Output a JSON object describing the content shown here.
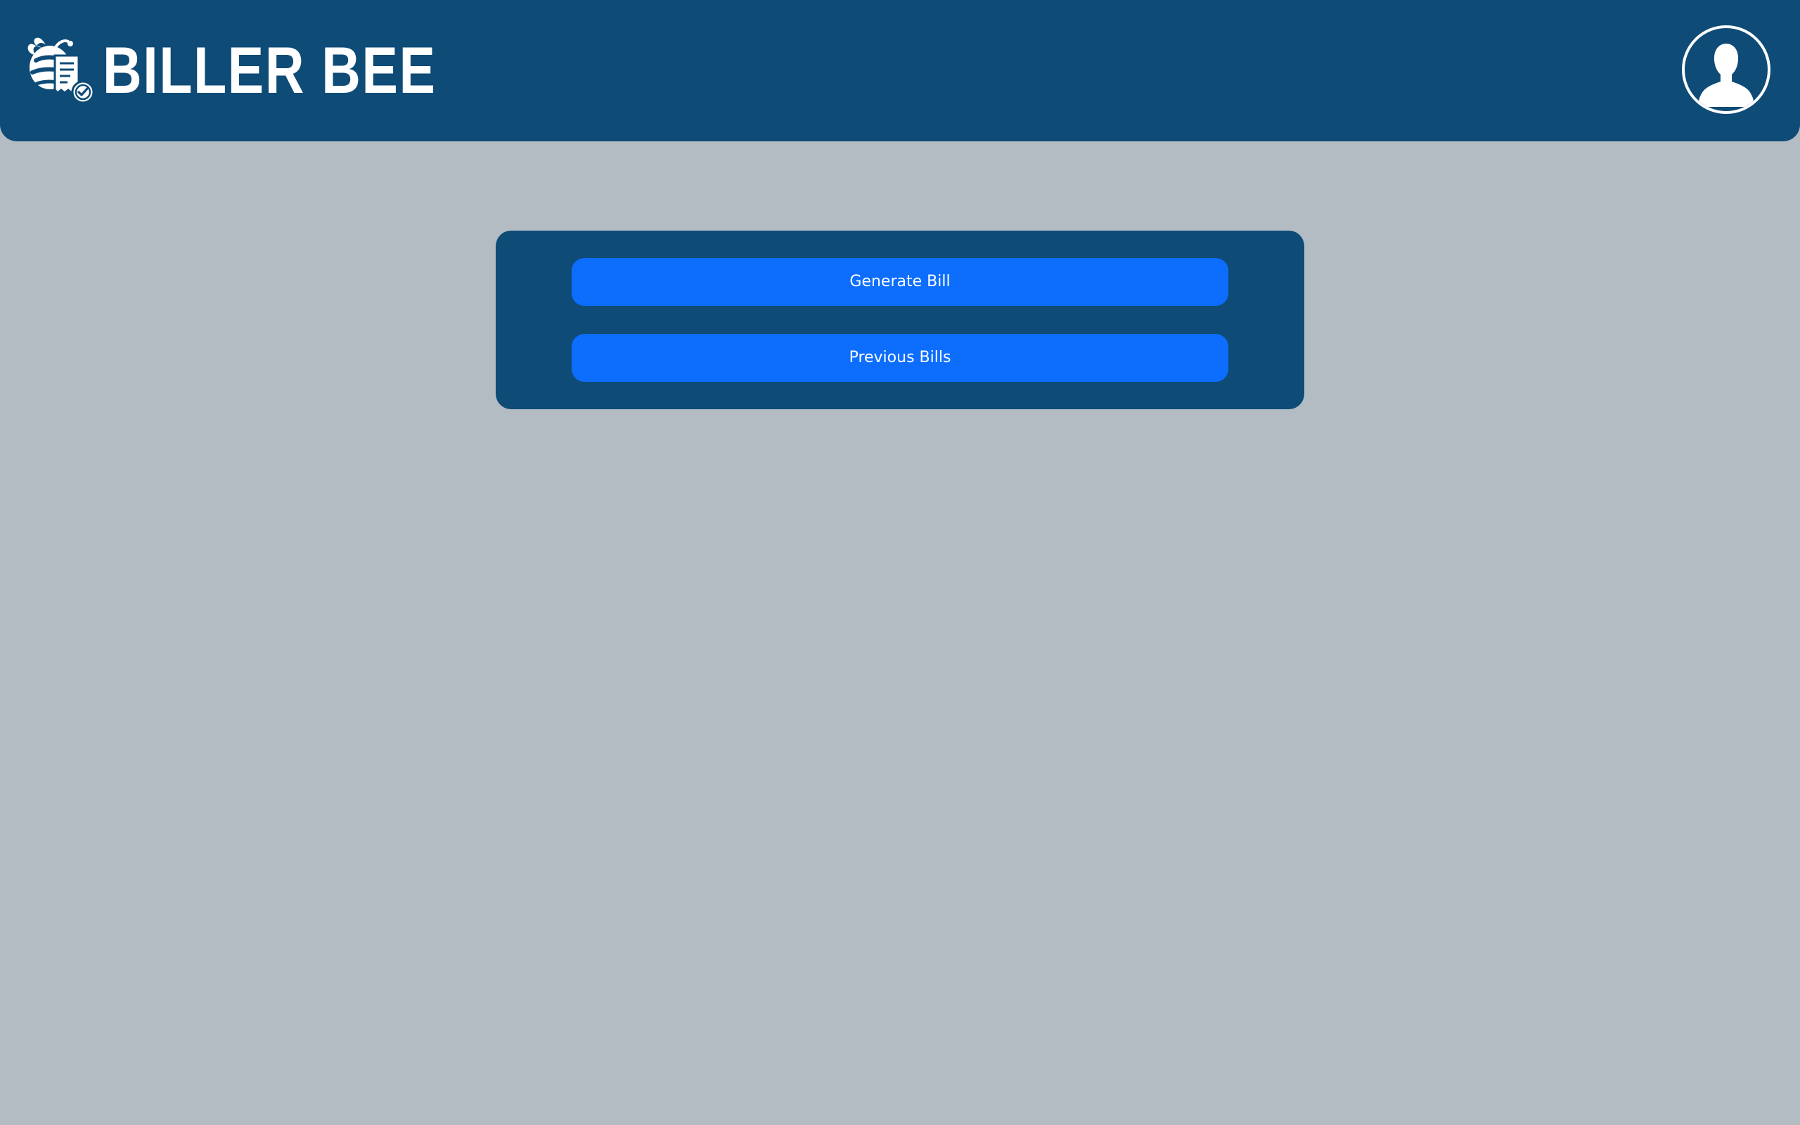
{
  "header": {
    "brand_name": "BILLER BEE",
    "logo_icon": "bee-receipt-check-icon",
    "profile_icon": "user-avatar-icon"
  },
  "menu": {
    "generate_bill_label": "Generate Bill",
    "previous_bills_label": "Previous Bills"
  },
  "colors": {
    "header_background": "#0e4b77",
    "page_background": "#b3bcc3",
    "button_background": "#0d6efd",
    "text": "#ffffff"
  }
}
